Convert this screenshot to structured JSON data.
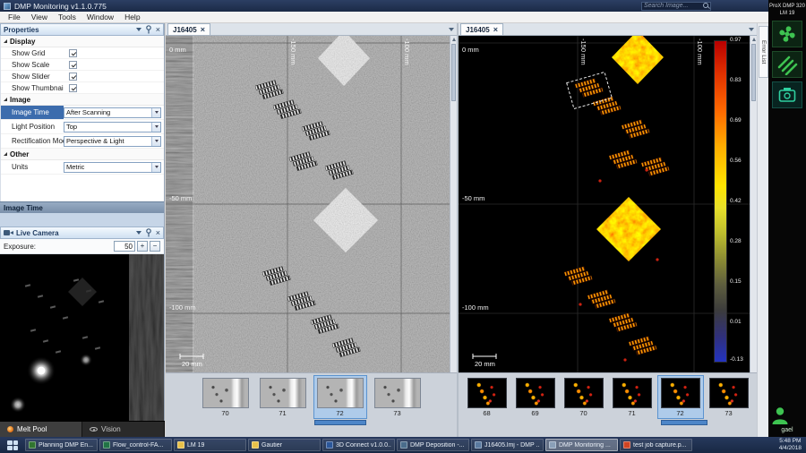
{
  "colors": {
    "accent_blue": "#4d86c8",
    "selection_blue": "#3c6cad",
    "status_green": "#3ec351",
    "status_teal": "#2fd0a0",
    "taskbar_navy": "#1b2a47"
  },
  "icons": {
    "search": "magnifier",
    "panel_menu": "caret-down",
    "pin": "pushpin",
    "close": "x",
    "dropdown": "caret-down",
    "melt_pool": "melt-pool-dot",
    "vision": "eye",
    "fan": "fan-status",
    "layers": "layers-status",
    "camera": "camera",
    "user": "person",
    "start": "windows-flag"
  },
  "titlebar": {
    "title": "DMP Monitoring v1.1.0.775",
    "search_placeholder": "Search Image..."
  },
  "menubar": {
    "items": [
      "File",
      "View",
      "Tools",
      "Window",
      "Help"
    ]
  },
  "properties": {
    "title": "Properties",
    "groups": {
      "display": "Display",
      "image": "Image",
      "other": "Other"
    },
    "checks": [
      {
        "label": "Show Grid",
        "checked": true
      },
      {
        "label": "Show Scale",
        "checked": true
      },
      {
        "label": "Show Slider",
        "checked": true
      },
      {
        "label": "Show Thumbnails",
        "checked": true
      }
    ],
    "fields": [
      {
        "label": "Image Time",
        "value": "After Scanning"
      },
      {
        "label": "Light Position",
        "value": "Top"
      },
      {
        "label": "Rectification Mode",
        "value": "Perspective & Light"
      },
      {
        "label": "Units",
        "value": "Metric"
      }
    ],
    "description_title": "Image Time"
  },
  "live_camera": {
    "title": "Live Camera",
    "exposure_label": "Exposure:",
    "exposure_value": "50",
    "increase_label": "+",
    "decrease_label": "−"
  },
  "bottom_tabs": {
    "items": [
      "Melt Pool",
      "Vision"
    ]
  },
  "center_viewer": {
    "tab": "J16405",
    "ruler_top": [
      "-150 mm",
      "-100 mm"
    ],
    "ruler_left": [
      "0 mm",
      "-50 mm",
      "-100 mm"
    ],
    "scale_label": "20 mm",
    "thumb_labels": [
      "70",
      "71",
      "72",
      "73"
    ],
    "selected_thumb": "72"
  },
  "right_viewer": {
    "tab": "J16405",
    "ruler_top": [
      "-150 mm",
      "-100 mm"
    ],
    "ruler_left": [
      "0 mm",
      "-50 mm",
      "-100 mm"
    ],
    "scale_label": "20 mm",
    "colorbar_ticks": [
      "0.97",
      "0.83",
      "0.69",
      "0.56",
      "0.42",
      "0.28",
      "0.15",
      "0.01",
      "-0.13"
    ],
    "thumb_labels": [
      "68",
      "69",
      "70",
      "71",
      "72",
      "73"
    ],
    "selected_thumb": "72"
  },
  "side_rail": {
    "machine_line1": "ProX DMP 320",
    "machine_line2": "LM 19",
    "error_list_tab": "Error List",
    "user_label": "gael"
  },
  "taskbar": {
    "apps": [
      {
        "label": "Planning DMP En...",
        "icon": "app",
        "icon_color": "#31752f"
      },
      {
        "label": "Flow_control-FA...",
        "icon": "spreadsheet",
        "icon_color": "#217346"
      },
      {
        "label": "LM 19",
        "icon": "folder",
        "icon_color": "#e8c149"
      },
      {
        "label": "Gautier",
        "icon": "folder",
        "icon_color": "#e8c149"
      },
      {
        "label": "3D Connect v1.0.0...",
        "icon": "app",
        "icon_color": "#2b579a"
      },
      {
        "label": "DMP Deposition -...",
        "icon": "app",
        "icon_color": "#4a6d8c"
      },
      {
        "label": "J16405.lmj - DMP ...",
        "icon": "document",
        "icon_color": "#5a7aa0"
      },
      {
        "label": "DMP Monitoring ...",
        "icon": "app",
        "icon_color": "#8aa0b8",
        "active": true
      },
      {
        "label": "test job capture.p...",
        "icon": "presentation",
        "icon_color": "#d04423"
      }
    ],
    "clock_time": "5:48 PM",
    "clock_date": "4/4/2018"
  }
}
